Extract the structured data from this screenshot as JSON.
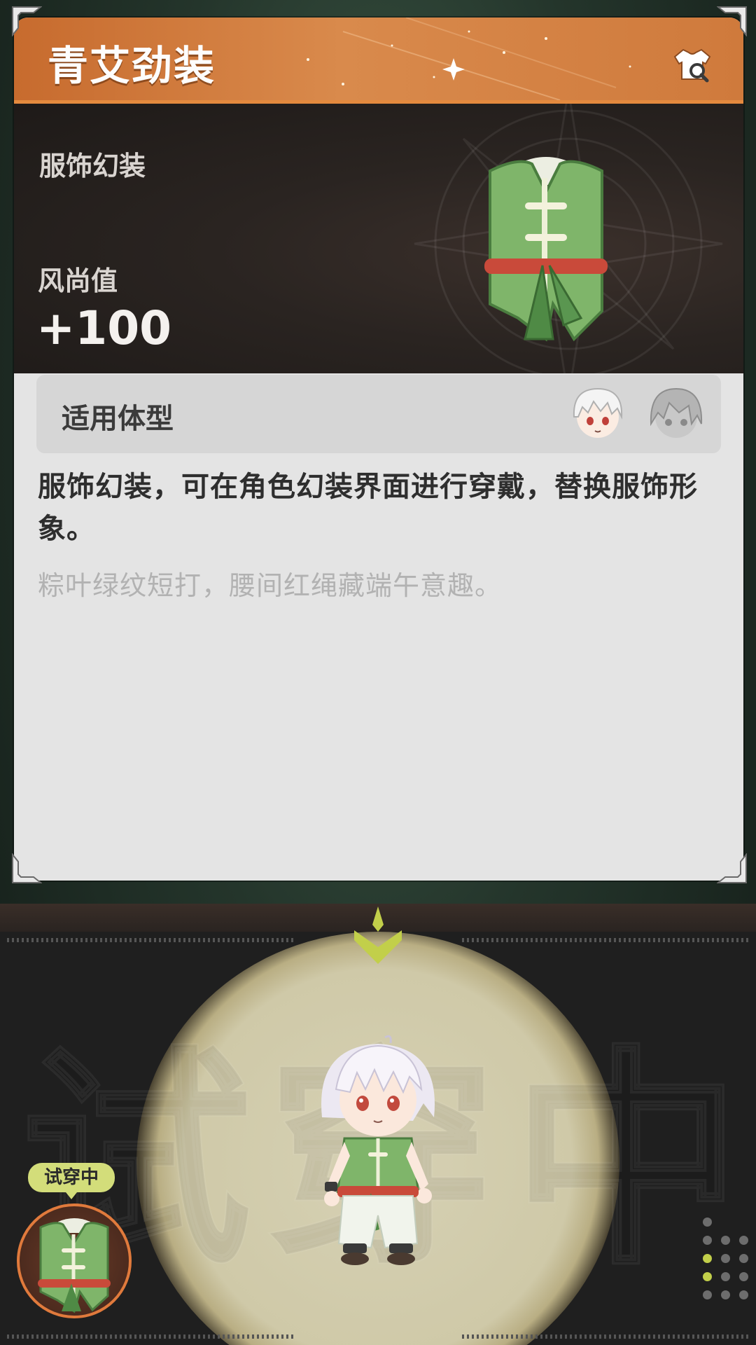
{
  "item": {
    "name": "青艾劲装",
    "type": "服饰幻装",
    "fashion_label": "风尚值",
    "fashion_value": "+100"
  },
  "body_type": {
    "label": "适用体型"
  },
  "description": "服饰幻装，可在角色幻装界面进行穿戴，替换服饰形象。",
  "flavor_text": "粽叶绿纹短打，腰间红绳藏端午意趣。",
  "preview": {
    "watermark_text": "试穿中",
    "badge_text": "试穿中"
  },
  "icons": {
    "wardrobe": "wardrobe-search-icon",
    "avatar_active": "white-hair-avatar-icon",
    "avatar_inactive": "grey-hair-avatar-icon",
    "arrow": "chevron-down-emblem-icon"
  },
  "colors": {
    "title_bar": "#d17c3e",
    "card_bg": "#e4e4e4",
    "badge": "#d3dd7a",
    "slot_border": "#e07a3c",
    "accent_green": "#c2cf4a"
  }
}
